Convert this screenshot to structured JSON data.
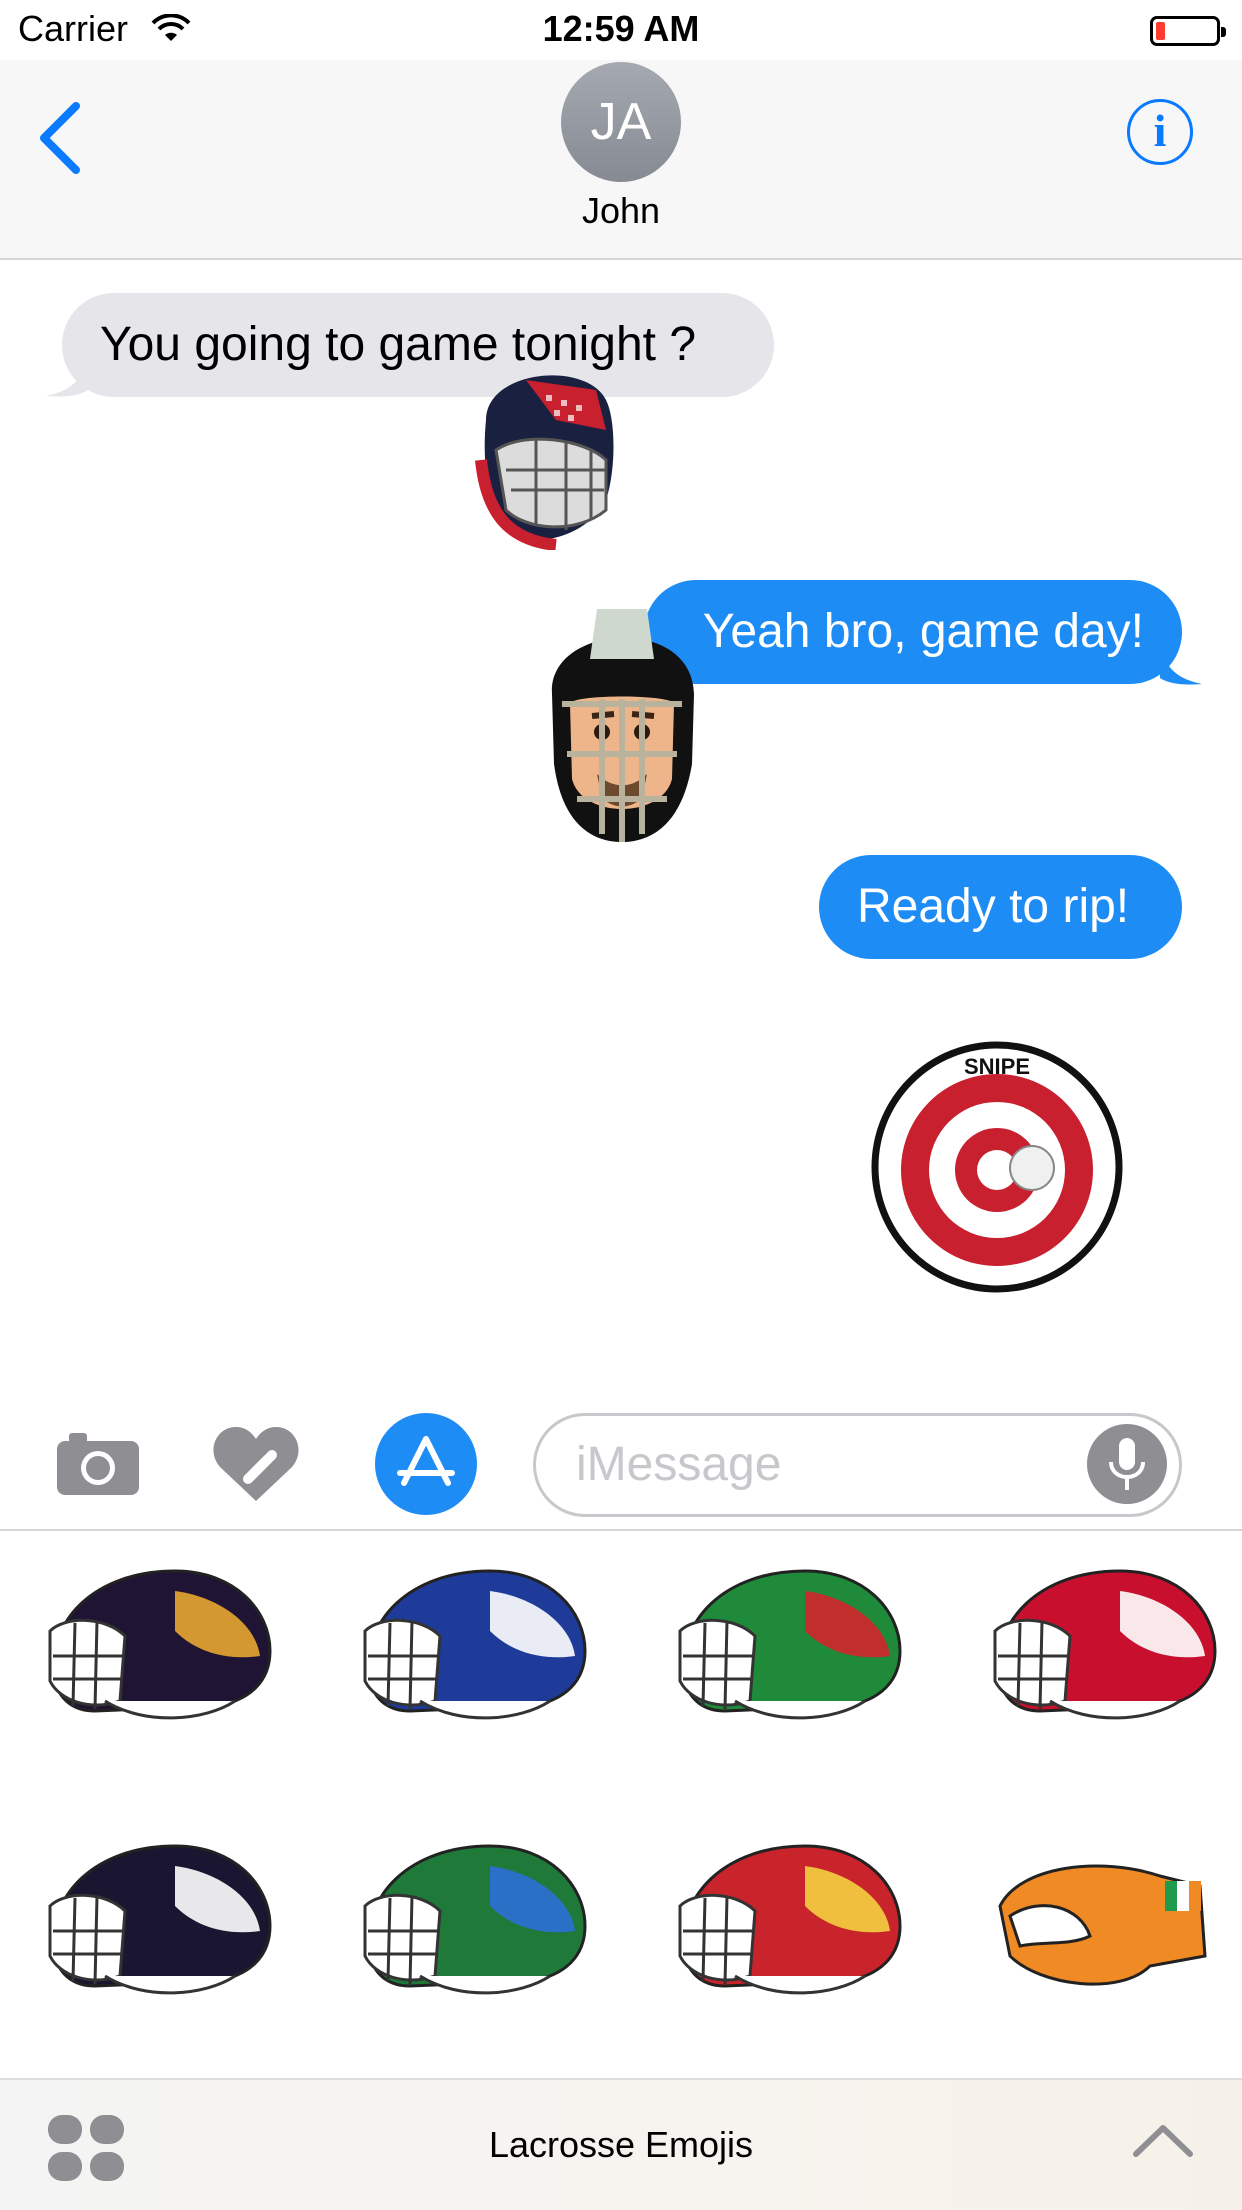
{
  "status_bar": {
    "carrier": "Carrier",
    "time": "12:59 AM"
  },
  "header": {
    "avatar_initials": "JA",
    "contact_name": "John"
  },
  "messages": [
    {
      "direction": "incoming",
      "text": "You going to game tonight ?"
    },
    {
      "direction": "outgoing",
      "text": "Yeah bro, game day!"
    },
    {
      "direction": "outgoing",
      "text": "Ready to rip!"
    }
  ],
  "stickers_in_chat": [
    {
      "kind": "helmet",
      "label": ""
    },
    {
      "kind": "goalie-face",
      "label": ""
    },
    {
      "kind": "target",
      "label": "SNIPE"
    }
  ],
  "compose": {
    "placeholder": "iMessage"
  },
  "sticker_drawer": {
    "app_name": "Lacrosse Emojis",
    "items": [
      {
        "name": "helmet-eagle",
        "shell": "#1f1433",
        "accent": "#e8a630"
      },
      {
        "name": "helmet-israel",
        "shell": "#1f3b9a",
        "accent": "#ffffff"
      },
      {
        "name": "helmet-italy",
        "shell": "#1e8a3a",
        "accent": "#d3252c"
      },
      {
        "name": "helmet-japan",
        "shell": "#c8102e",
        "accent": "#ffffff"
      },
      {
        "name": "helmet-scots",
        "shell": "#1a1530",
        "accent": "#ffffff"
      },
      {
        "name": "helmet-earth",
        "shell": "#1f7a3a",
        "accent": "#2b6fd6"
      },
      {
        "name": "helmet-uganda",
        "shell": "#c9242b",
        "accent": "#f4d03f"
      },
      {
        "name": "glove-ireland",
        "shell": "#f08a24",
        "accent": "#1e9b4c"
      }
    ]
  },
  "colors": {
    "accent": "#0a7aff",
    "outgoing_bubble": "#1e8cf5",
    "incoming_bubble": "#e5e5ea"
  }
}
